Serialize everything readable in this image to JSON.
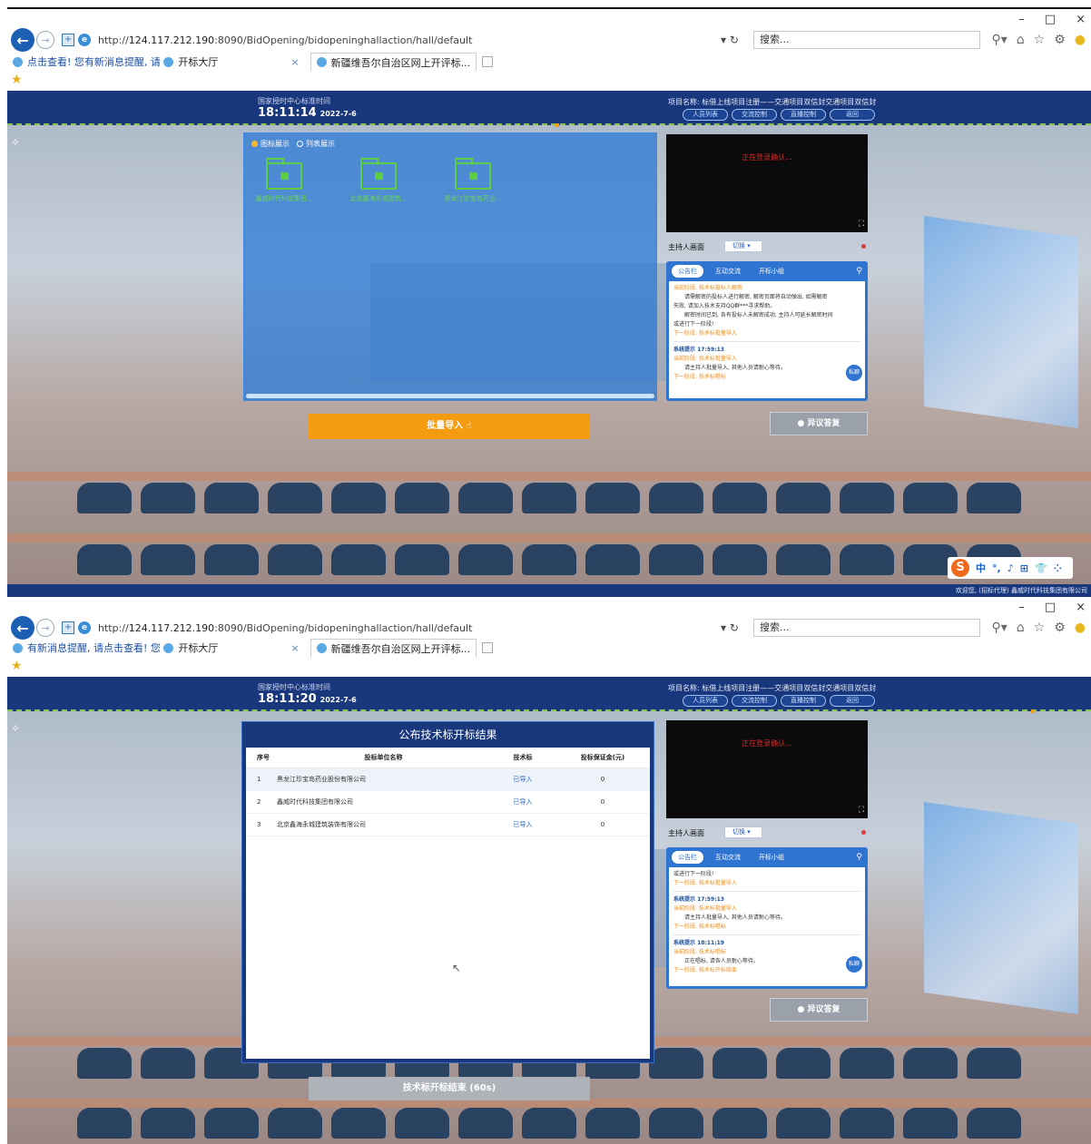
{
  "browser": {
    "url_prefix": "http://",
    "url_host": "124.117.212.190",
    "url_rest": ":8090/BidOpening/bidopeninghallaction/hall/default",
    "search_placeholder": "搜索...",
    "window_controls": [
      "–",
      "□",
      "×"
    ],
    "icons": [
      "back-arrow-icon",
      "forward-arrow-icon",
      "refresh-icon",
      "search-icon",
      "home-icon",
      "star-icon",
      "gear-icon",
      "smiley-icon"
    ]
  },
  "shot1": {
    "tabs": {
      "notice_label": "点击查看! 您有新消息提醒, 请",
      "active_label": "开标大厅",
      "other_label": "新疆维吾尔自治区网上开评标..."
    },
    "header": {
      "clock_label": "国家授时中心标准时间",
      "time": "18:11:14",
      "date": "2022-7-6",
      "project": "项目名称: 标借上线项目注册——交通项目双信封交通项目双信封",
      "buttons": [
        "人员列表",
        "交流控制",
        "直播控制",
        "返回"
      ]
    },
    "files": {
      "radio_icon_view": "图标展示",
      "radio_list_view": "列表展示",
      "folders": [
        "鑫威时代科技集团...",
        "北京鑫海永城建筑...",
        "黑龙江珍宝岛药业..."
      ]
    },
    "batch_import_label": "批量导入",
    "video_status": "正在登录确认...",
    "host_label": "主持人画面",
    "switch_label": "切换 ▾",
    "chat": {
      "tabs": [
        "公告栏",
        "互动交流",
        "开标小组"
      ],
      "lines": [
        {
          "cls": "orange",
          "text": "当前阶段: 技术标投标人解密"
        },
        {
          "cls": "indent",
          "text": "请需解密的投标人进行解密, 解密页面将自动弹出, 如需解密"
        },
        {
          "cls": "",
          "text": "失败, 请加入技术支持QQ群***寻求帮助。"
        },
        {
          "cls": "indent",
          "text": "解密时间已到, 各有投标人未解密成功, 主持人可延长解密时间"
        },
        {
          "cls": "",
          "text": "或进行下一阶段!"
        },
        {
          "cls": "orange",
          "text": "下一阶段: 技术标批量导入"
        },
        {
          "cls": "sep",
          "text": ""
        },
        {
          "cls": "sender",
          "text": "系统提示 17:59:13"
        },
        {
          "cls": "orange",
          "text": "当前阶段: 技术标批量导入"
        },
        {
          "cls": "indent",
          "text": "请主持人批量导入, 其他人员请耐心等待。"
        },
        {
          "cls": "orange",
          "text": "下一阶段: 技术标唱标"
        }
      ],
      "private_label": "私聊"
    },
    "objection_label": "异议答复",
    "ime": {
      "logo": "S",
      "items": [
        "中",
        "°,",
        "♪",
        "⊞",
        "👕",
        "⁘"
      ]
    },
    "welcome": "欢迎您, (招标代理) 鑫威时代科技集团有限公司"
  },
  "shot2": {
    "tabs": {
      "notice_label": "有新消息提醒, 请点击查看! 您",
      "active_label": "开标大厅",
      "other_label": "新疆维吾尔自治区网上开评标..."
    },
    "header": {
      "clock_label": "国家授时中心标准时间",
      "time": "18:11:20",
      "date": "2022-7-6",
      "project": "项目名称: 标借上线项目注册——交通项目双信封交通项目双信封",
      "buttons": [
        "人员列表",
        "交流控制",
        "直播控制",
        "返回"
      ]
    },
    "results": {
      "title": "公布技术标开标结果",
      "columns": [
        "序号",
        "投标单位名称",
        "技术标",
        "投标保证金(元)"
      ],
      "rows": [
        {
          "no": "1",
          "name": "黑龙江珍宝岛药业股份有限公司",
          "tech": "已导入",
          "deposit": "0"
        },
        {
          "no": "2",
          "name": "鑫威时代科技集团有限公司",
          "tech": "已导入",
          "deposit": "0"
        },
        {
          "no": "3",
          "name": "北京鑫海永城建筑装饰有限公司",
          "tech": "已导入",
          "deposit": "0"
        }
      ]
    },
    "result_button_label": "技术标开标结束 (60s)",
    "video_status": "正在登录确认...",
    "host_label": "主持人画面",
    "switch_label": "切换 ▾",
    "chat": {
      "tabs": [
        "公告栏",
        "互动交流",
        "开标小组"
      ],
      "lines": [
        {
          "cls": "",
          "text": "或进行下一阶段!"
        },
        {
          "cls": "orange",
          "text": "下一阶段: 技术标批量导入"
        },
        {
          "cls": "sep",
          "text": ""
        },
        {
          "cls": "sender",
          "text": "系统提示 17:59:13"
        },
        {
          "cls": "orange",
          "text": "当前阶段: 技术标批量导入"
        },
        {
          "cls": "indent",
          "text": "请主持人批量导入, 其他人员请耐心等待。"
        },
        {
          "cls": "orange",
          "text": "下一阶段: 技术标唱标"
        },
        {
          "cls": "sep",
          "text": ""
        },
        {
          "cls": "sender",
          "text": "系统提示 18:11:19"
        },
        {
          "cls": "orange",
          "text": "当前阶段: 技术标唱标"
        },
        {
          "cls": "indent",
          "text": "正在唱标, 请各人员耐心等待。"
        },
        {
          "cls": "orange",
          "text": "下一阶段: 技术标开标结束"
        }
      ],
      "private_label": "私聊"
    },
    "objection_label": "异议答复"
  }
}
